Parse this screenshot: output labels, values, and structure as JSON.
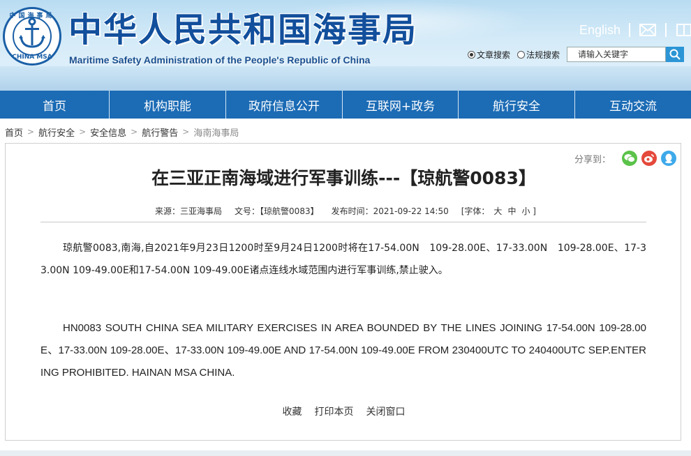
{
  "header": {
    "title_cn": "中华人民共和国海事局",
    "title_en": "Maritime Safety Administration of the People's Republic of China",
    "logo_text_top": "中国海事局",
    "logo_text_bottom": "CHINA MSA",
    "lang_link": "English",
    "search": {
      "options": [
        {
          "label": "文章搜索",
          "selected": true
        },
        {
          "label": "法规搜索",
          "selected": false
        }
      ],
      "placeholder": "请输入关键字"
    }
  },
  "nav": {
    "items": [
      "首页",
      "机构职能",
      "政府信息公开",
      "互联网+政务",
      "航行安全",
      "互动交流"
    ]
  },
  "breadcrumb": [
    "首页",
    "航行安全",
    "安全信息",
    "航行警告",
    "海南海事局"
  ],
  "article": {
    "share_label": "分享到：",
    "title": "在三亚正南海域进行军事训练---【琼航警0083】",
    "meta": {
      "source": "来源：三亚海事局",
      "doc_no": "文号：【琼航警0083】",
      "published": "发布时间：2021-09-22 14:50",
      "font_label": "[字体：",
      "font_large": "大",
      "font_medium": "中",
      "font_small": "小 ]"
    },
    "para_cn": "琼航警0083,南海,自2021年9月23日1200时至9月24日1200时将在17-54.00N　109-28.00E、17-33.00N　109-28.00E、17-33.00N 109-49.00E和17-54.00N 109-49.00E诸点连线水域范围内进行军事训练,禁止驶入。",
    "para_en": "HN0083 SOUTH CHINA SEA MILITARY EXERCISES IN AREA BOUNDED BY THE LINES JOINING 17-54.00N 109-28.00E、17-33.00N 109-28.00E、17-33.00N 109-49.00E AND 17-54.00N 109-49.00E FROM 230400UTC  TO 240400UTC SEP.ENTERING PROHIBITED. HAINAN MSA CHINA.",
    "actions": [
      "收藏",
      "打印本页",
      "关闭窗口"
    ]
  },
  "colors": {
    "nav_bg": "#1b6bb5",
    "brand_blue": "#124f9c",
    "wechat": "#5bc24a",
    "weibo": "#e4493b",
    "qq": "#3ea9ea"
  }
}
